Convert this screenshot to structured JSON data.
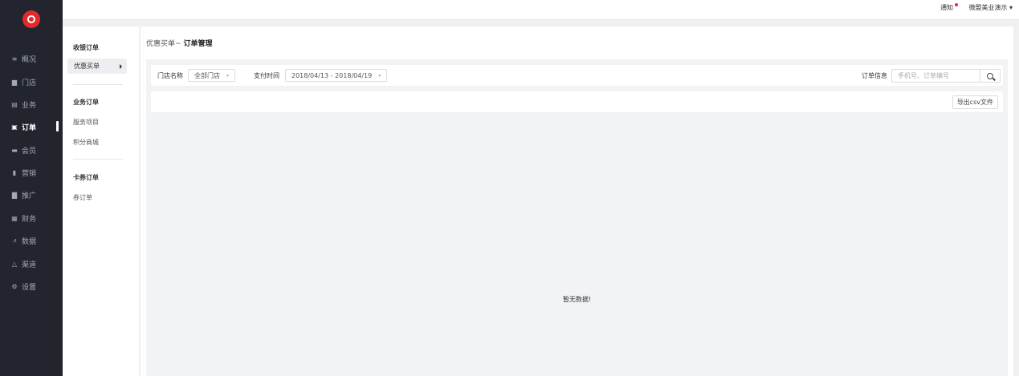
{
  "topbar": {
    "notice": "通知",
    "user": "微盟美业演示",
    "user_caret": "▾"
  },
  "nav": {
    "items": [
      {
        "label": "概况",
        "icon": "≡"
      },
      {
        "label": "门店",
        "icon": "▆"
      },
      {
        "label": "业务",
        "icon": "▤"
      },
      {
        "label": "订单",
        "icon": "▣"
      },
      {
        "label": "会员",
        "icon": "▬"
      },
      {
        "label": "营销",
        "icon": "▮"
      },
      {
        "label": "推广",
        "icon": "▇"
      },
      {
        "label": "财务",
        "icon": "▦"
      },
      {
        "label": "数据",
        "icon": "⩘"
      },
      {
        "label": "渠道",
        "icon": "△"
      },
      {
        "label": "设置",
        "icon": "⚙"
      }
    ]
  },
  "subnav": {
    "group1": "收银订单",
    "active": "优惠买单",
    "group2": "业务订单",
    "service_items": "服务项目",
    "points_mall": "积分商城",
    "group3": "卡券订单",
    "coupon_orders": "券订单"
  },
  "breadcrumb": {
    "parent": "优惠买单",
    "sep": "~",
    "current": "订单管理"
  },
  "filters": {
    "store_label": "门店名称",
    "store_value": "全部门店",
    "pay_time_label": "支付时间",
    "pay_time_value": "2018/04/13 - 2018/04/19",
    "order_info_label": "订单信息",
    "order_info_placeholder": "手机号、订单编号",
    "caret": "▾"
  },
  "actions": {
    "export": "导出csv文件"
  },
  "empty_text": "暂无数据!",
  "colors": {
    "nav_bg": "#22252e",
    "brand_red": "#e12b2b"
  }
}
